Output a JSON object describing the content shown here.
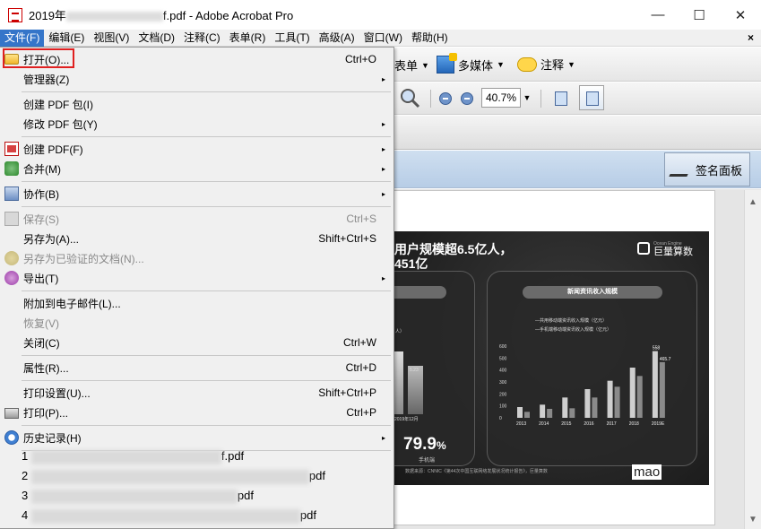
{
  "window": {
    "title_prefix": "2019年",
    "title_suffix": "f.pdf - Adobe Acrobat Pro",
    "minimize": "—",
    "maximize": "☐",
    "close": "✕"
  },
  "menubar": {
    "items": [
      "文件(F)",
      "编辑(E)",
      "视图(V)",
      "文档(D)",
      "注释(C)",
      "表单(R)",
      "工具(T)",
      "高级(A)",
      "窗口(W)",
      "帮助(H)"
    ],
    "close_doc": "×"
  },
  "toolbar": {
    "form_label": "表单",
    "multimedia_label": "多媒体",
    "comment_label": "注释",
    "zoom_value": "40.7%"
  },
  "sign_panel": {
    "label": "签名面板"
  },
  "file_menu": {
    "items": [
      {
        "label": "打开(O)...",
        "shortcut": "Ctrl+O"
      },
      {
        "label": "管理器(Z)",
        "submenu": "▸"
      },
      {
        "label": "创建 PDF 包(I)"
      },
      {
        "label": "修改 PDF 包(Y)",
        "submenu": "▸"
      },
      {
        "label": "创建 PDF(F)",
        "submenu": "▸"
      },
      {
        "label": "合并(M)",
        "submenu": "▸"
      },
      {
        "label": "协作(B)",
        "submenu": "▸"
      },
      {
        "label": "保存(S)",
        "shortcut": "Ctrl+S"
      },
      {
        "label": "另存为(A)...",
        "shortcut": "Shift+Ctrl+S"
      },
      {
        "label": "另存为已验证的文档(N)..."
      },
      {
        "label": "导出(T)",
        "submenu": "▸"
      },
      {
        "label": "附加到电子邮件(L)..."
      },
      {
        "label": "恢复(V)"
      },
      {
        "label": "关闭(C)",
        "shortcut": "Ctrl+W"
      },
      {
        "label": "属性(R)...",
        "shortcut": "Ctrl+D"
      },
      {
        "label": "打印设置(U)...",
        "shortcut": "Shift+Ctrl+P"
      },
      {
        "label": "打印(P)...",
        "shortcut": "Ctrl+P"
      },
      {
        "label": "历史记录(H)",
        "submenu": "▸"
      }
    ],
    "recent_files": [
      {
        "prefix": "1",
        "suffix": "f.pdf"
      },
      {
        "prefix": "2",
        "suffix": "pdf"
      },
      {
        "prefix": "3",
        "suffix": "pdf"
      },
      {
        "prefix": "4",
        "suffix": "pdf"
      }
    ]
  },
  "slide": {
    "title_line1": "用户规模超6.5亿人，",
    "title_line2": "451亿",
    "logo_text": "巨量算数",
    "logo_subtext": "Ocean Engine",
    "right_panel_title": "新闻资讯收入规模",
    "legend_1": "—共用移动端资讯收入规模（亿元）",
    "legend_2": "—手机端移动端资讯收入规模（亿元）",
    "y_ticks": [
      "600",
      "500",
      "400",
      "300",
      "200",
      "100",
      "0"
    ],
    "x_ticks": [
      "2013",
      "2014",
      "2015",
      "2016",
      "2017",
      "2018",
      "2019E"
    ],
    "bar_label_1": "558",
    "bar_label_2": "465.7",
    "big_number": "79.9",
    "big_number_unit": "%",
    "big_number_label": "手机端",
    "left_panel_month_label": "2019年12月",
    "left_panel_label_a": "人）",
    "left_panel_value_b": "5.23",
    "footnote": "数据来源：CNNIC《第44次中国互联网络发展状况统计报告》，巨量算数",
    "watermark": "mao"
  },
  "chart_data": {
    "type": "bar",
    "categories": [
      "2013",
      "2014",
      "2015",
      "2016",
      "2017",
      "2018",
      "2019E"
    ],
    "series": [
      {
        "values": [
          90,
          110,
          170,
          240,
          310,
          420,
          558
        ]
      },
      {
        "values": [
          50,
          75,
          80,
          170,
          260,
          350,
          465.7
        ]
      }
    ],
    "ylim": [
      0,
      600
    ],
    "title": "新闻资讯收入规模"
  }
}
